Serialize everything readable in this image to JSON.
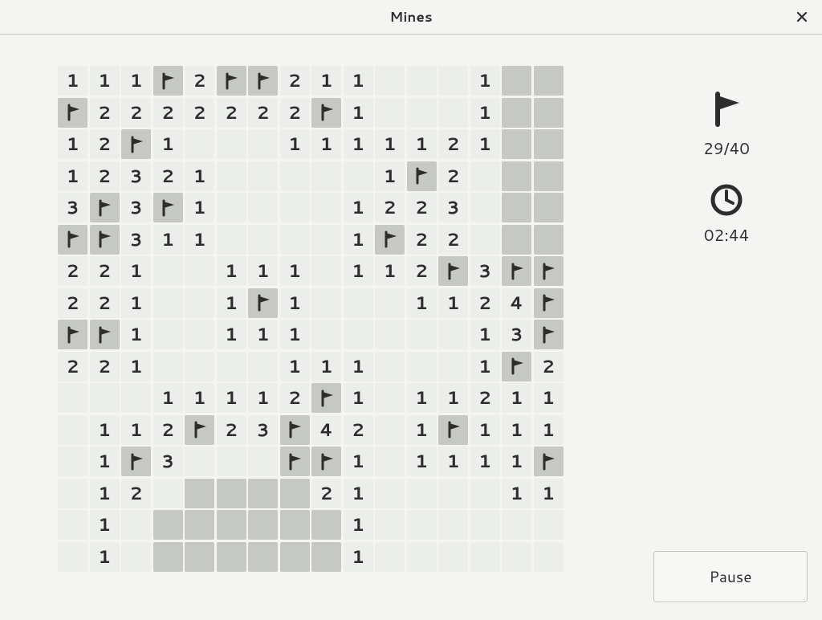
{
  "window": {
    "title": "Mines"
  },
  "status": {
    "flags_placed": 29,
    "total_mines": 40,
    "flag_label": "29/40",
    "timer": "02:44"
  },
  "controls": {
    "pause_label": "Pause"
  },
  "board": {
    "cols": 16,
    "rows": 16,
    "grid": [
      [
        "1",
        "1",
        "1",
        "F",
        "2",
        "F",
        "F",
        "2",
        "1",
        "1",
        ".",
        ".",
        ".",
        "1",
        "U",
        "U"
      ],
      [
        "F",
        "2",
        "2",
        "2",
        "2",
        "2",
        "2",
        "2",
        "F",
        "1",
        ".",
        ".",
        ".",
        "1",
        "U",
        "U"
      ],
      [
        "1",
        "2",
        "F",
        "1",
        ".",
        ".",
        ".",
        "1",
        "1",
        "1",
        "1",
        "1",
        "2",
        "1",
        "U",
        "U"
      ],
      [
        "1",
        "2",
        "3",
        "2",
        "1",
        ".",
        ".",
        ".",
        ".",
        ".",
        "1",
        "F",
        "2",
        ".",
        "U",
        "U"
      ],
      [
        "3",
        "F",
        "3",
        "F",
        "1",
        ".",
        ".",
        ".",
        ".",
        "1",
        "2",
        "2",
        "3",
        ".",
        "U",
        "U"
      ],
      [
        "F",
        "F",
        "3",
        "1",
        "1",
        ".",
        ".",
        ".",
        ".",
        "1",
        "F",
        "2",
        "2",
        ".",
        "U",
        "U"
      ],
      [
        "2",
        "2",
        "1",
        ".",
        ".",
        "1",
        "1",
        "1",
        ".",
        "1",
        "1",
        "2",
        "F",
        "3",
        "F",
        "F"
      ],
      [
        "2",
        "2",
        "1",
        ".",
        ".",
        "1",
        "F",
        "1",
        ".",
        ".",
        ".",
        "1",
        "1",
        "2",
        "4",
        "F"
      ],
      [
        "F",
        "F",
        "1",
        ".",
        ".",
        "1",
        "1",
        "1",
        ".",
        ".",
        ".",
        ".",
        ".",
        "1",
        "3",
        "F"
      ],
      [
        "2",
        "2",
        "1",
        ".",
        ".",
        ".",
        ".",
        "1",
        "1",
        "1",
        ".",
        ".",
        ".",
        "1",
        "F",
        "2"
      ],
      [
        ".",
        ".",
        ".",
        "1",
        "1",
        "1",
        "1",
        "2",
        "F",
        "1",
        ".",
        "1",
        "1",
        "2",
        "1",
        "1"
      ],
      [
        ".",
        "1",
        "1",
        "2",
        "F",
        "2",
        "3",
        "F",
        "4",
        "2",
        ".",
        "1",
        "F",
        "1",
        "1",
        "1"
      ],
      [
        ".",
        "1",
        "F",
        "3",
        ".",
        ".",
        ".",
        "F",
        "F",
        "1",
        ".",
        "1",
        "1",
        "1",
        "1",
        "F"
      ],
      [
        ".",
        "1",
        "2",
        ".",
        "U",
        "U",
        "U",
        "U",
        "2",
        "1",
        ".",
        ".",
        ".",
        ".",
        "1",
        "1"
      ],
      [
        ".",
        "1",
        ".",
        "U",
        "U",
        "U",
        "U",
        "U",
        "U",
        "1",
        ".",
        ".",
        ".",
        ".",
        ".",
        "."
      ],
      [
        ".",
        "1",
        ".",
        "U",
        "U",
        "U",
        "U",
        "U",
        "U",
        "1",
        ".",
        ".",
        ".",
        ".",
        ".",
        "."
      ]
    ]
  }
}
